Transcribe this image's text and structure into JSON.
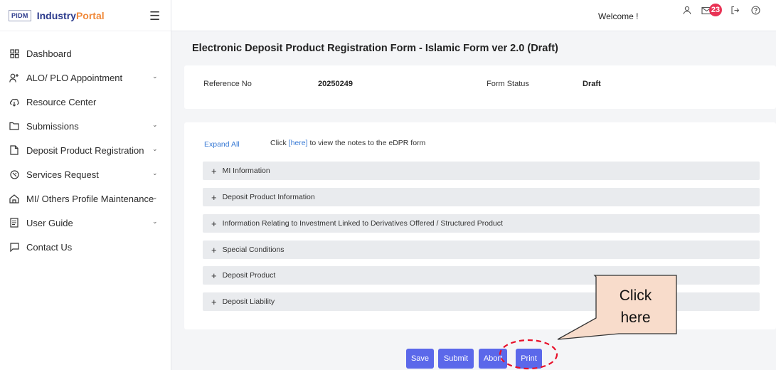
{
  "brand": {
    "logo": "PIDM",
    "name_part1": "Industry",
    "name_part2": "Portal"
  },
  "sidebar": {
    "items": [
      {
        "label": "Dashboard",
        "icon": "grid-icon",
        "has_chevron": false
      },
      {
        "label": "ALO/ PLO Appointment",
        "icon": "user-add-icon",
        "has_chevron": true
      },
      {
        "label": "Resource Center",
        "icon": "cloud-download-icon",
        "has_chevron": false
      },
      {
        "label": "Submissions",
        "icon": "folder-icon",
        "has_chevron": true
      },
      {
        "label": "Deposit Product Registration",
        "icon": "file-icon",
        "has_chevron": true
      },
      {
        "label": "Services Request",
        "icon": "tools-icon",
        "has_chevron": true
      },
      {
        "label": "MI/ Others Profile Maintenance",
        "icon": "home-icon",
        "has_chevron": true
      },
      {
        "label": "User Guide",
        "icon": "document-icon",
        "has_chevron": true
      },
      {
        "label": "Contact Us",
        "icon": "chat-icon",
        "has_chevron": false
      }
    ]
  },
  "topbar": {
    "welcome": "Welcome !",
    "notification_count": "23"
  },
  "page": {
    "title": "Electronic Deposit Product Registration Form - Islamic Form ver 2.0 (Draft)",
    "reference_label": "Reference No",
    "reference_value": "20250249",
    "status_label": "Form Status",
    "status_value": "Draft"
  },
  "form": {
    "expand_all": "Expand All",
    "notes_prefix": "Click ",
    "notes_link": "[here]",
    "notes_suffix": " to view the notes to the eDPR form",
    "sections": [
      "MI Information",
      "Deposit Product Information",
      "Information Relating to Investment Linked to Derivatives Offered / Structured Product",
      "Special Conditions",
      "Deposit Product",
      "Deposit Liability"
    ]
  },
  "actions": {
    "save": "Save",
    "submit": "Submit",
    "abort": "Abort",
    "print": "Print"
  },
  "callout": {
    "line1": "Click",
    "line2": "here"
  },
  "colors": {
    "accent": "#5b68ea",
    "badge": "#e93355",
    "link": "#3a7bd5",
    "brand_orange": "#f08a3c",
    "brand_navy": "#2b3a8c",
    "callout_fill": "#f8dccb",
    "highlight": "#e8102a"
  }
}
